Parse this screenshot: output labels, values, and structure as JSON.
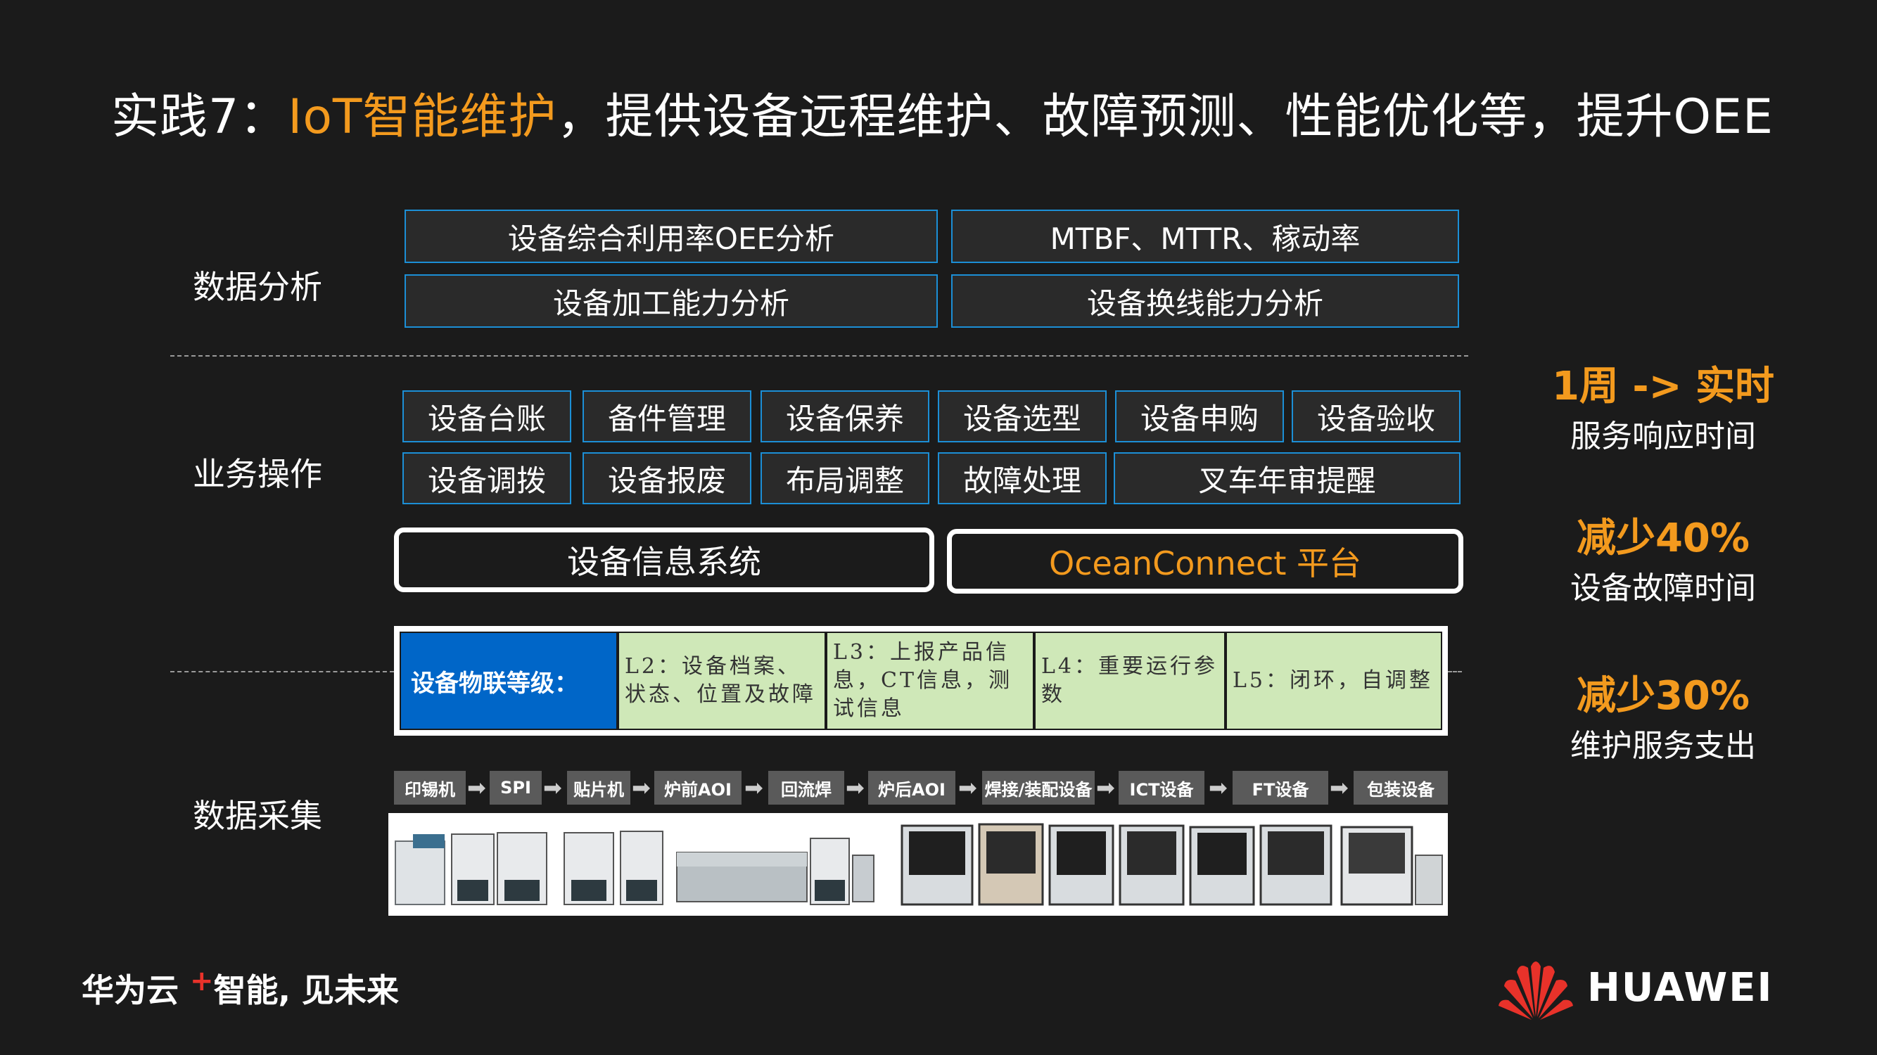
{
  "title": {
    "prefix": "实践7：",
    "highlight": "IoT智能维护",
    "suffix": "，提供设备远程维护、故障预测、性能优化等，提升OEE"
  },
  "sections": {
    "data_analysis": "数据分析",
    "business_ops": "业务操作",
    "data_collection": "数据采集"
  },
  "analysis": [
    "设备综合利用率OEE分析",
    "MTBF、MTTR、稼动率",
    "设备加工能力分析",
    "设备换线能力分析"
  ],
  "ops_row1": [
    "设备台账",
    "备件管理",
    "设备保养",
    "设备选型",
    "设备申购",
    "设备验收"
  ],
  "ops_row2": [
    "设备调拨",
    "设备报废",
    "布局调整",
    "故障处理",
    "叉车年审提醒"
  ],
  "systems": {
    "left": "设备信息系统",
    "right": "OceanConnect 平台"
  },
  "iot_levels": {
    "header": "设备物联等级：",
    "cells": [
      "L2：设备档案、状态、位置及故障",
      "L3：上报产品信息，CT信息，测试信息",
      "L4：重要运行参数",
      "L5：闭环，自调整"
    ]
  },
  "process": [
    "印锡机",
    "SPI",
    "贴片机",
    "炉前AOI",
    "回流焊",
    "炉后AOI",
    "焊接/装配设备",
    "ICT设备",
    "FT设备",
    "包装设备"
  ],
  "metrics": [
    {
      "big": "1周 -> 实时",
      "sub": "服务响应时间"
    },
    {
      "big": "减少40%",
      "sub": "设备故障时间"
    },
    {
      "big": "减少30%",
      "sub": "维护服务支出"
    }
  ],
  "footer": {
    "brand_left": "华为云",
    "plus": "+",
    "slogan": "智能, 见未来"
  },
  "brand_right": "HUAWEI",
  "colors": {
    "accent": "#f39a1e",
    "border_blue": "#1c8fd6",
    "iot_blue": "#0066c8",
    "iot_green": "#cfe8b8"
  }
}
